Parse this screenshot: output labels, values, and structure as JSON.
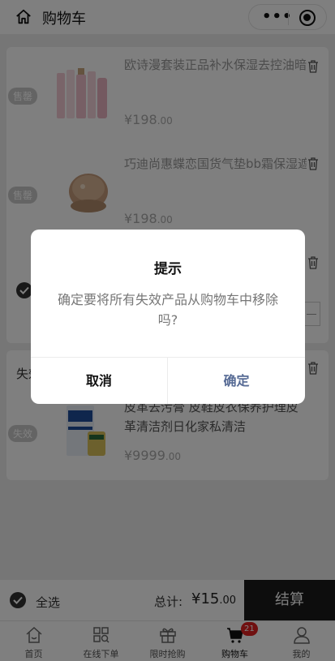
{
  "header": {
    "title": "购物车"
  },
  "cart": {
    "items": [
      {
        "badge": "售罄",
        "name": "欧诗漫套装正品补水保湿去控油暗",
        "price": "¥198",
        "price_dec": ".00"
      },
      {
        "badge": "售罄",
        "name": "巧迪尚惠蝶恋国货气垫bb霜保湿遮",
        "price": "¥198",
        "price_dec": ".00"
      }
    ],
    "invalid_section": {
      "label": "失效",
      "item": {
        "badge": "失效",
        "name": "皮革去污膏 皮鞋皮衣保养护理皮革清洁剂日化家私清洁",
        "price": "¥9999",
        "price_dec": ".00"
      }
    }
  },
  "footer": {
    "select_all": "全选",
    "total_label": "总计:",
    "total_value": "¥15",
    "total_dec": ".00",
    "checkout": "结算"
  },
  "tabbar": {
    "tabs": [
      {
        "label": "首页"
      },
      {
        "label": "在线下单"
      },
      {
        "label": "限时抢购"
      },
      {
        "label": "购物车",
        "badge": "21"
      },
      {
        "label": "我的"
      }
    ]
  },
  "dialog": {
    "title": "提示",
    "message": "确定要将所有失效产品从购物车中移除吗?",
    "cancel": "取消",
    "confirm": "确定",
    "confirm_color": "#576b95"
  }
}
